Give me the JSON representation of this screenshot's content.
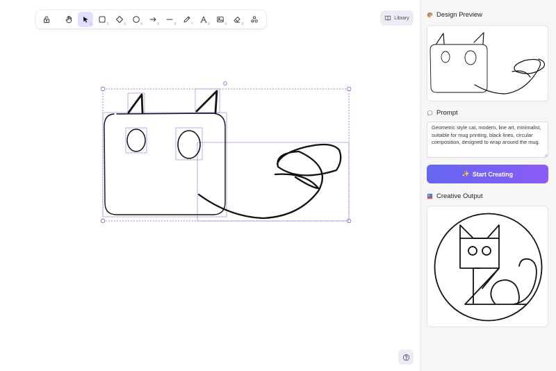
{
  "toolbar": {
    "tools": [
      {
        "name": "lock",
        "num": ""
      },
      {
        "name": "hand",
        "num": ""
      },
      {
        "name": "selection",
        "num": "1"
      },
      {
        "name": "rectangle",
        "num": "2"
      },
      {
        "name": "diamond",
        "num": "3"
      },
      {
        "name": "ellipse",
        "num": "4"
      },
      {
        "name": "arrow",
        "num": "5"
      },
      {
        "name": "line",
        "num": "6"
      },
      {
        "name": "draw",
        "num": "7"
      },
      {
        "name": "text",
        "num": "8"
      },
      {
        "name": "image",
        "num": "9"
      },
      {
        "name": "eraser",
        "num": "0"
      },
      {
        "name": "more-tools",
        "num": ""
      }
    ],
    "active_tool": "selection"
  },
  "library": {
    "label": "Library",
    "icon": "book-icon"
  },
  "help": {
    "icon": "question-circle-icon"
  },
  "panel": {
    "design_preview_title": "Design Preview",
    "prompt_title": "Prompt",
    "prompt_text": "Geometric style cat, modern, line art, minimalist, suitable for mug printing, black lines, circular composition, designed to wrap around the mug.",
    "start_button_label": "Start Creating",
    "start_button_icon": "✨",
    "creative_output_title": "Creative Output"
  },
  "colors": {
    "accent_start": "#6366f1",
    "accent_end": "#8b5cf6",
    "selection": "#6965db",
    "active_tool_bg": "#e0dfff"
  }
}
